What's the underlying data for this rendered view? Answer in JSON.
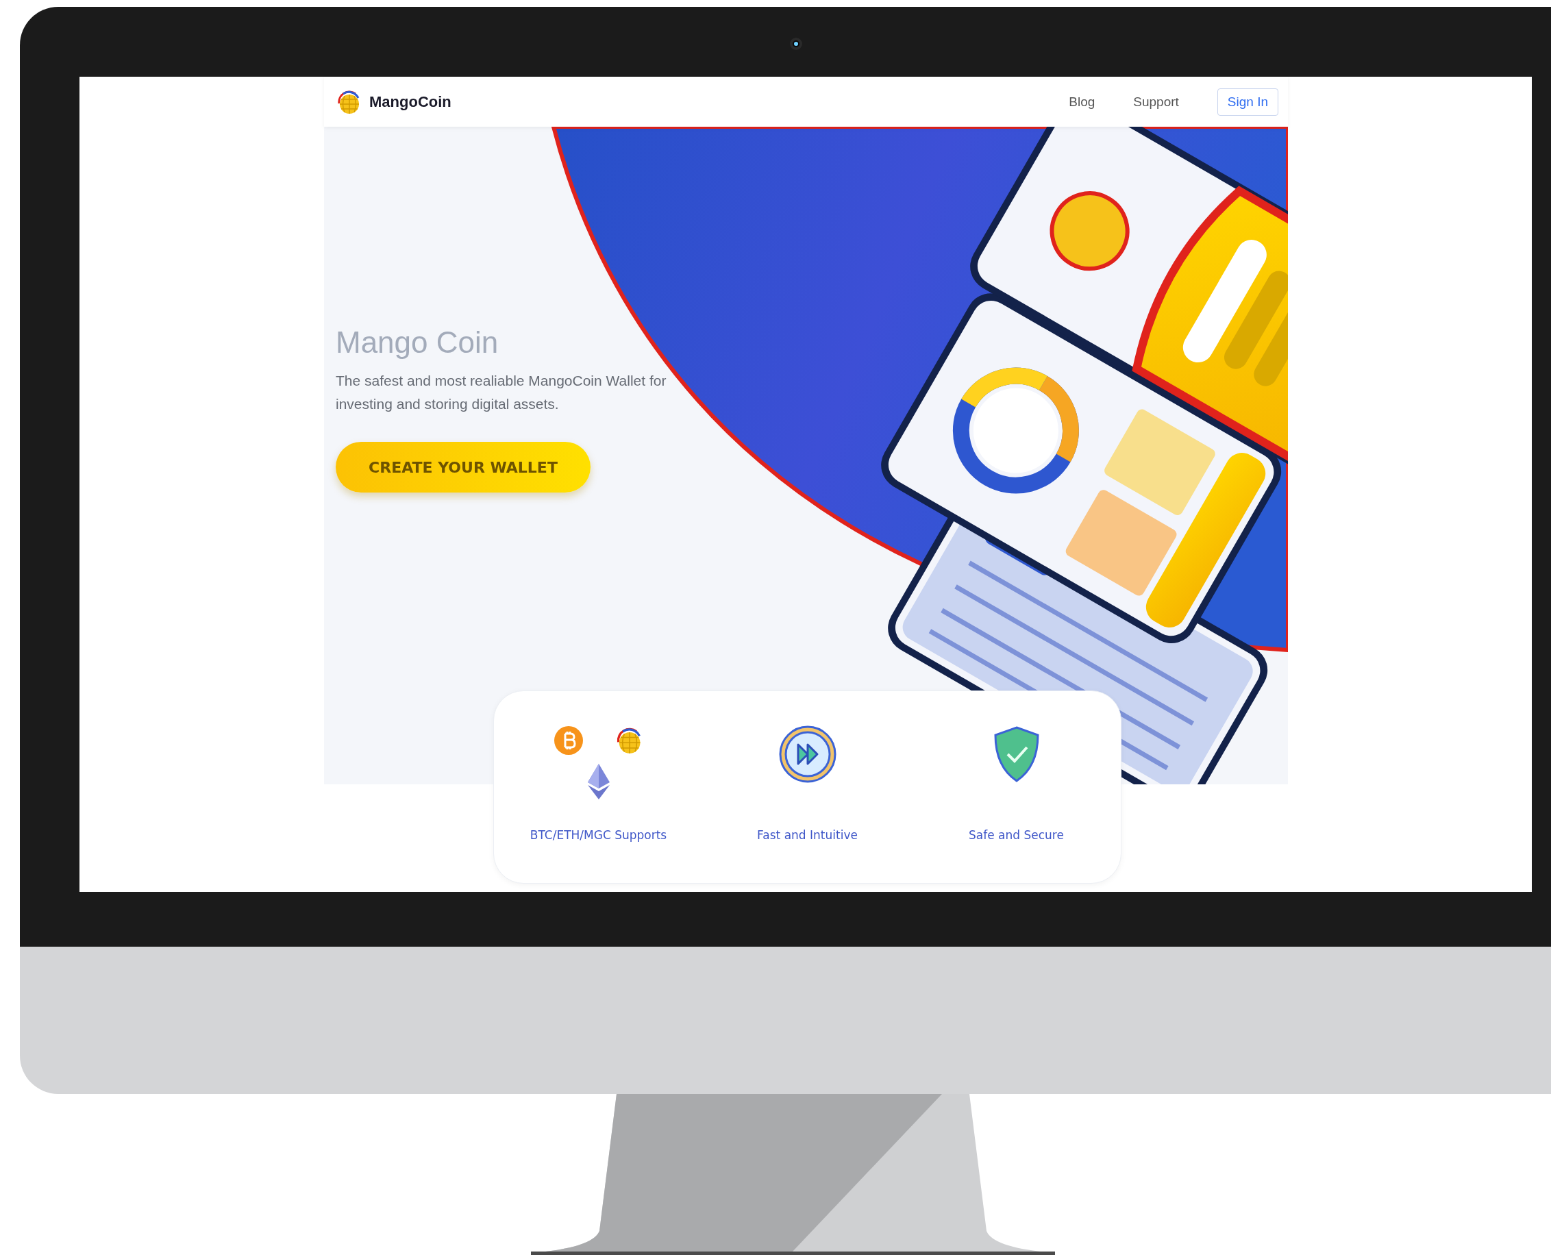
{
  "header": {
    "logo": "MangoCoin",
    "nav": [
      {
        "label": "Blog"
      },
      {
        "label": "Support"
      }
    ],
    "sign_in": "Sign In"
  },
  "hero": {
    "title": "Mango Coin",
    "description": "The safest and most realiable MangoCoin Wallet for investing and storing digital assets.",
    "cta": "CREATE YOUR WALLET"
  },
  "features": [
    {
      "kind": "coins",
      "label": "BTC/ETH/MGC Supports"
    },
    {
      "kind": "speed",
      "label": "Fast and Intuitive"
    },
    {
      "kind": "shield",
      "label": "Safe and Secure"
    }
  ]
}
